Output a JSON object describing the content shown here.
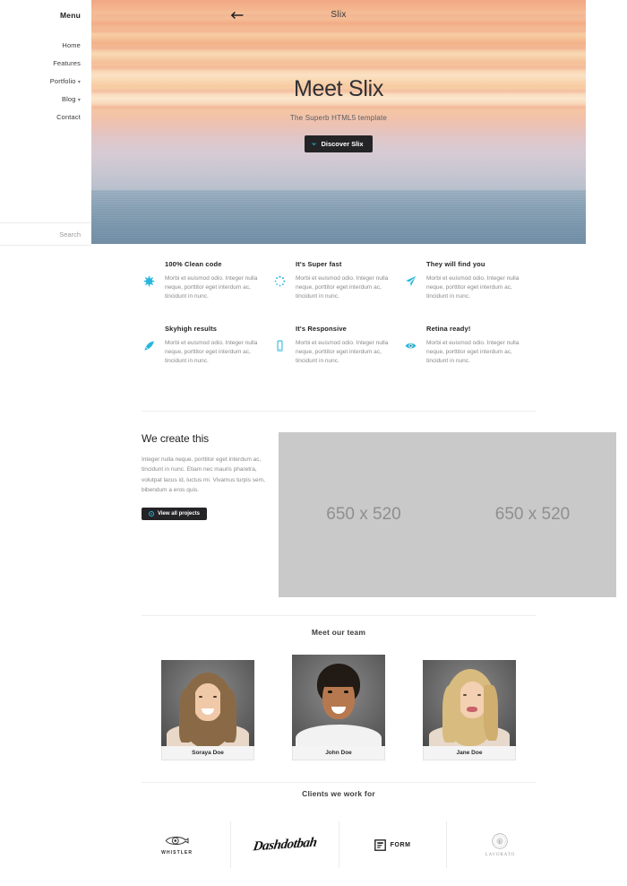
{
  "sidebar": {
    "menu_title": "Menu",
    "items": [
      {
        "label": "Home",
        "caret": ""
      },
      {
        "label": "Features",
        "caret": ""
      },
      {
        "label": "Portfolio",
        "caret": "▾"
      },
      {
        "label": "Blog",
        "caret": "▾"
      },
      {
        "label": "Contact",
        "caret": ""
      }
    ],
    "search_placeholder": "Search",
    "search_value": ""
  },
  "hero": {
    "logo": "Slix",
    "back_icon": "arrow-left-icon",
    "title": "Meet Slix",
    "subtitle": "The Superb HTML5 template",
    "cta_label": "Discover Slix",
    "cta_icon": "chevron-down-icon",
    "accent": "#29b6dd"
  },
  "features": [
    {
      "icon": "snowflake-icon",
      "title": "100% Clean code",
      "text": "Morbi et euismod odio. Integer nulla neque, porttitor eget interdum ac, tincidunt in nunc."
    },
    {
      "icon": "spinner-icon",
      "title": "It's Super fast",
      "text": "Morbi et euismod odio. Integer nulla neque, porttitor eget interdum ac, tincidunt in nunc."
    },
    {
      "icon": "paper-plane-icon",
      "title": "They will find you",
      "text": "Morbi et euismod odio. Integer nulla neque, porttitor eget interdum ac, tincidunt in nunc."
    },
    {
      "icon": "rocket-icon",
      "title": "Skyhigh results",
      "text": "Morbi et euismod odio. Integer nulla neque, porttitor eget interdum ac, tincidunt in nunc."
    },
    {
      "icon": "mobile-icon",
      "title": "It's Responsive",
      "text": "Morbi et euismod odio. Integer nulla neque, porttitor eget interdum ac, tincidunt in nunc."
    },
    {
      "icon": "eye-icon",
      "title": "Retina ready!",
      "text": "Morbi et euismod odio. Integer nulla neque, porttitor eget interdum ac, tincidunt in nunc."
    }
  ],
  "create": {
    "heading": "We create this",
    "text": "Integer nulla neque, porttitor eget interdum ac, tincidunt in nunc. Etiam nec mauris pharetra, volutpat lacus id, luctus mi. Vivamus turpis sem, bibendum a eros quis.",
    "button_label": "View all projects",
    "button_icon": "circle-arrow-icon",
    "placeholder_a": "650 x 520",
    "placeholder_b": "650 x 520",
    "placeholder_bg": "#c9c9c9"
  },
  "team": {
    "heading": "Meet our team",
    "members": [
      {
        "name": "Soraya Doe"
      },
      {
        "name": "John Doe"
      },
      {
        "name": "Jane Doe"
      }
    ]
  },
  "clients": {
    "heading": "Clients we work for",
    "logos": [
      {
        "name": "WHISTLER",
        "type": "mark-word",
        "icon": "whistler-eye-icon"
      },
      {
        "name": "Dashdotbah",
        "type": "script"
      },
      {
        "name": "FORM",
        "type": "box-word",
        "icon": "form-box-icon"
      },
      {
        "name": "LAVORATO",
        "type": "crest-word",
        "icon": "lavorato-crest-icon"
      }
    ]
  }
}
